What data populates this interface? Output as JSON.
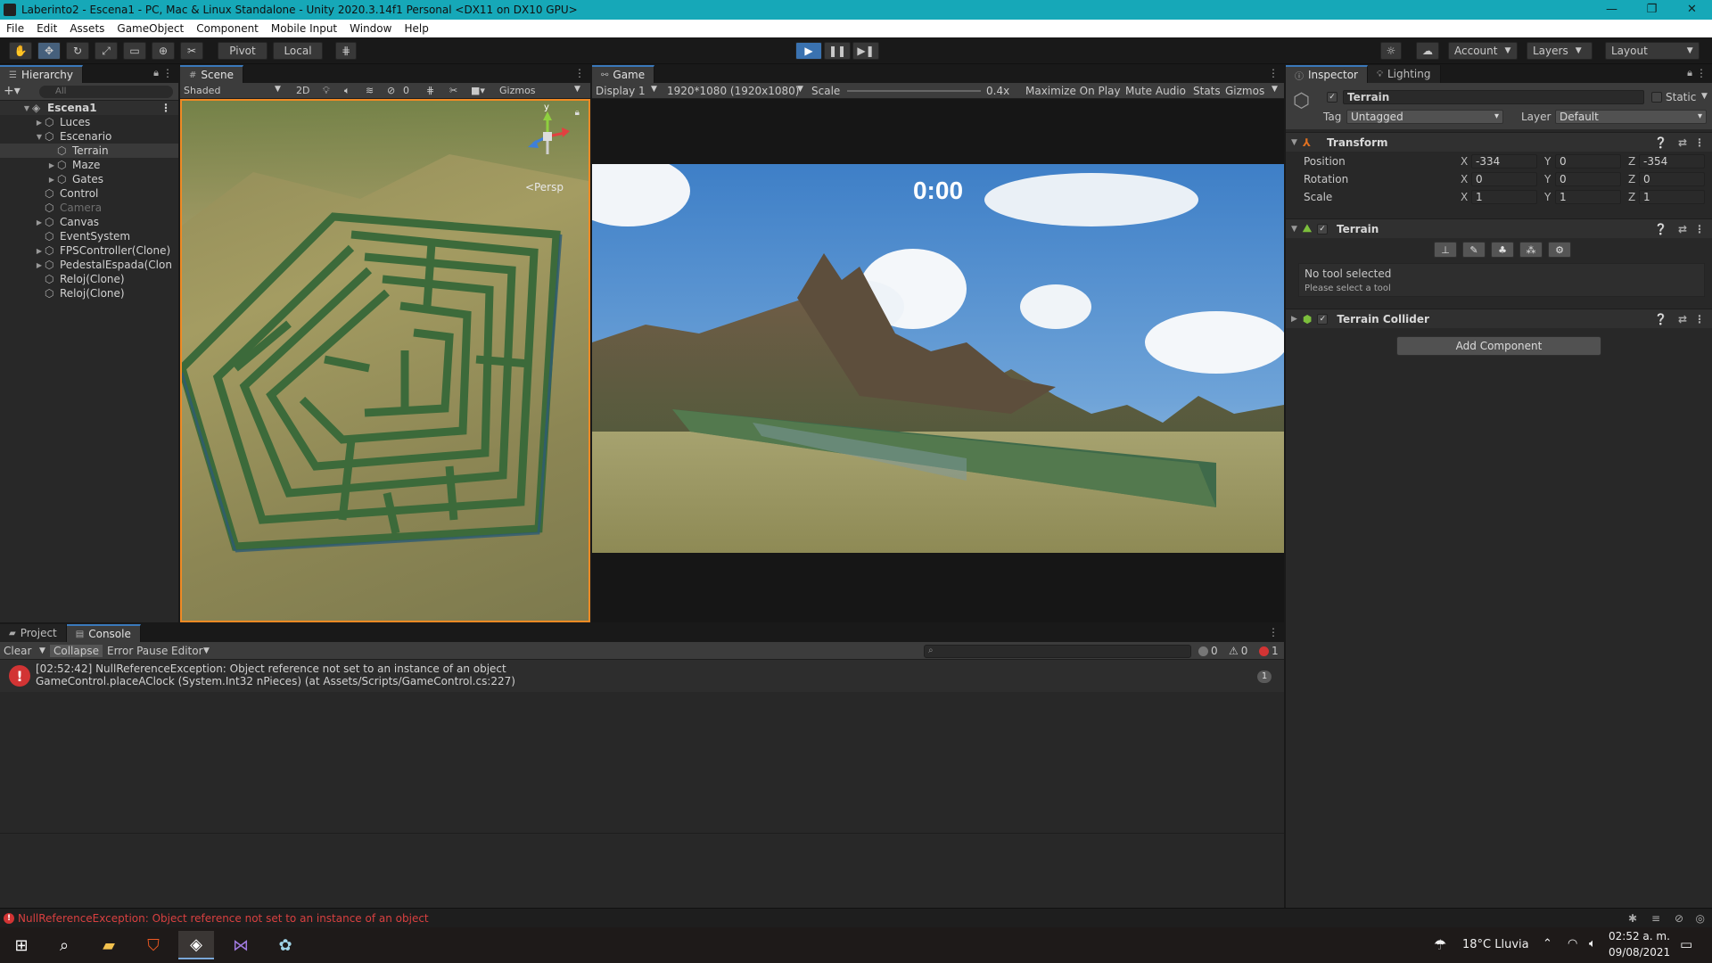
{
  "window": {
    "title": "Laberinto2 - Escena1 - PC, Mac & Linux Standalone - Unity 2020.3.14f1 Personal <DX11 on DX10 GPU>",
    "controls": [
      "—",
      "❐",
      "✕"
    ]
  },
  "menu": [
    "File",
    "Edit",
    "Assets",
    "GameObject",
    "Component",
    "Mobile Input",
    "Window",
    "Help"
  ],
  "toolbar": {
    "pivot_label": "Pivot",
    "local_label": "Local",
    "account_label": "Account",
    "layers_label": "Layers",
    "layout_label": "Layout"
  },
  "hierarchy": {
    "tab_label": "Hierarchy",
    "search_placeholder": "All",
    "scene_name": "Escena1",
    "items": [
      {
        "label": "Luces",
        "depth": 1,
        "arrow": "▶",
        "dim": false
      },
      {
        "label": "Escenario",
        "depth": 1,
        "arrow": "▼",
        "dim": false
      },
      {
        "label": "Terrain",
        "depth": 2,
        "arrow": "",
        "dim": false,
        "selected": true
      },
      {
        "label": "Maze",
        "depth": 2,
        "arrow": "▶",
        "dim": false
      },
      {
        "label": "Gates",
        "depth": 2,
        "arrow": "▶",
        "dim": false
      },
      {
        "label": "Control",
        "depth": 1,
        "arrow": "",
        "dim": false
      },
      {
        "label": "Camera",
        "depth": 1,
        "arrow": "",
        "dim": true
      },
      {
        "label": "Canvas",
        "depth": 1,
        "arrow": "▶",
        "dim": false
      },
      {
        "label": "EventSystem",
        "depth": 1,
        "arrow": "",
        "dim": false
      },
      {
        "label": "FPSController(Clone)",
        "depth": 1,
        "arrow": "▶",
        "dim": false
      },
      {
        "label": "PedestalEspada(Clon",
        "depth": 1,
        "arrow": "▶",
        "dim": false
      },
      {
        "label": "Reloj(Clone)",
        "depth": 1,
        "arrow": "",
        "dim": false
      },
      {
        "label": "Reloj(Clone)",
        "depth": 1,
        "arrow": "",
        "dim": false
      }
    ]
  },
  "scene": {
    "tab_label": "Scene",
    "shading": "Shaded",
    "mode_2d": "2D",
    "hidden_count": "0",
    "gizmos_label": "Gizmos",
    "persp_label": "<Persp",
    "gizmo_axis_y": "y"
  },
  "game": {
    "tab_label": "Game",
    "display": "Display 1",
    "resolution": "1920*1080 (1920x1080)",
    "scale_label": "Scale",
    "scale_value": "0.4x",
    "maximize_label": "Maximize On Play",
    "mute_label": "Mute Audio",
    "stats_label": "Stats",
    "gizmos_label": "Gizmos",
    "timer": "0:00"
  },
  "inspector": {
    "tab_label": "Inspector",
    "lighting_tab_label": "Lighting",
    "object_name": "Terrain",
    "static_label": "Static",
    "tag_label": "Tag",
    "tag_value": "Untagged",
    "layer_label": "Layer",
    "layer_value": "Default",
    "transform": {
      "title": "Transform",
      "rows": [
        {
          "label": "Position",
          "x": "-334",
          "y": "0",
          "z": "-354"
        },
        {
          "label": "Rotation",
          "x": "0",
          "y": "0",
          "z": "0"
        },
        {
          "label": "Scale",
          "x": "1",
          "y": "1",
          "z": "1"
        }
      ]
    },
    "terrain": {
      "title": "Terrain",
      "tools": [
        "⊥",
        "✎",
        "♣",
        "⁂",
        "⚙"
      ],
      "no_tool": "No tool selected",
      "hint": "Please select a tool"
    },
    "collider_title": "Terrain Collider",
    "add_component": "Add Component"
  },
  "console": {
    "project_tab": "Project",
    "console_tab": "Console",
    "clear": "Clear",
    "collapse": "Collapse",
    "error_pause": "Error Pause",
    "editor": "Editor",
    "log_count": "0",
    "warn_count": "0",
    "error_count": "1",
    "entry_line1": "[02:52:42] NullReferenceException: Object reference not set to an instance of an object",
    "entry_line2": "GameControl.placeAClock (System.Int32 nPieces) (at Assets/Scripts/GameControl.cs:227)",
    "entry_count": "1"
  },
  "statusbar": {
    "message": "NullReferenceException: Object reference not set to an instance of an object"
  },
  "taskbar": {
    "weather": "18°C  Lluvia",
    "time": "02:52 a. m.",
    "date": "09/08/2021"
  },
  "colors": {
    "titlebar": "#16a8b8",
    "selection_outline": "#f08a24",
    "error": "#d23434",
    "accent": "#3a79bb"
  }
}
